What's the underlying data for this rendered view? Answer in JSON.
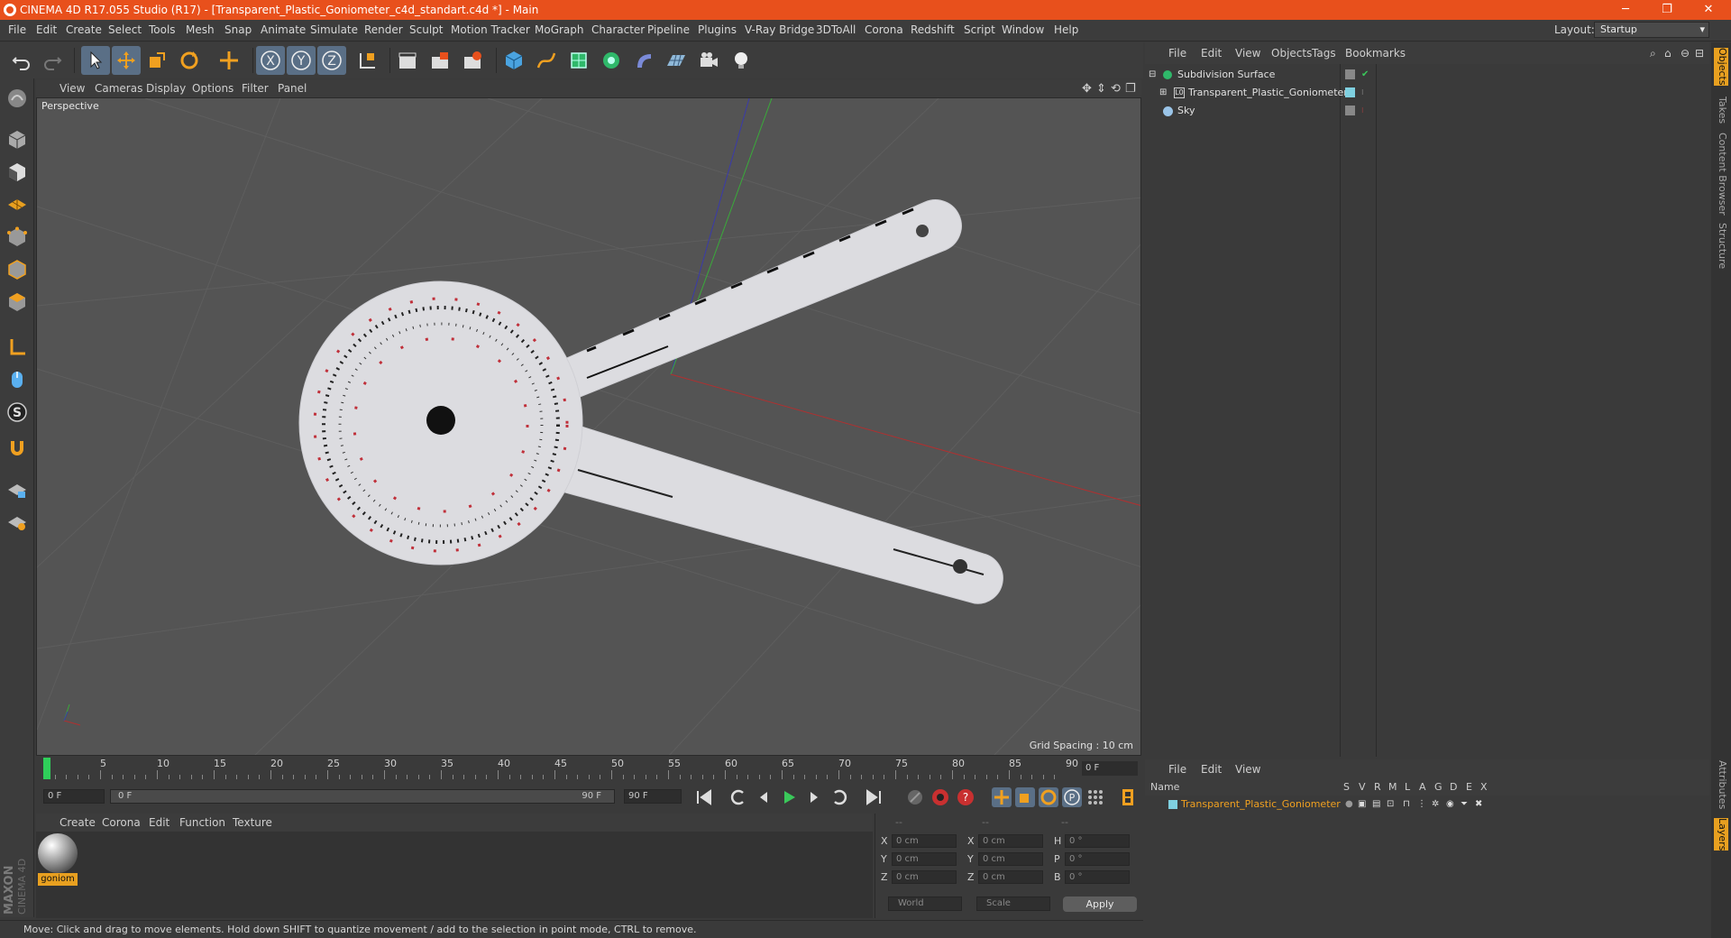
{
  "window": {
    "title": "CINEMA 4D R17.055 Studio (R17) - [Transparent_Plastic_Goniometer_c4d_standart.c4d *] - Main",
    "minimize": "─",
    "restore": "❐",
    "close": "✕"
  },
  "menu": [
    "File",
    "Edit",
    "Create",
    "Select",
    "Tools",
    "Mesh",
    "Snap",
    "Animate",
    "Simulate",
    "Render",
    "Sculpt",
    "Motion Tracker",
    "MoGraph",
    "Character",
    "Pipeline",
    "Plugins",
    "V-Ray Bridge",
    "3DToAll",
    "Corona",
    "Redshift",
    "Script",
    "Window",
    "Help"
  ],
  "layout": {
    "label": "Layout:",
    "value": "Startup"
  },
  "viewport": {
    "menu": [
      "View",
      "Cameras",
      "Display",
      "Options",
      "Filter",
      "Panel"
    ],
    "label": "Perspective",
    "grid_spacing": "Grid Spacing : 10 cm"
  },
  "timeline": {
    "ticks": [
      "0",
      "5",
      "10",
      "15",
      "20",
      "25",
      "30",
      "35",
      "40",
      "45",
      "50",
      "55",
      "60",
      "65",
      "70",
      "75",
      "80",
      "85",
      "90"
    ],
    "current_frame": "0 F",
    "start_field": "0 F",
    "range_start": "0 F",
    "range_end": "90 F",
    "end_field": "90 F"
  },
  "material_manager": {
    "menu": [
      "Create",
      "Corona",
      "Edit",
      "Function",
      "Texture"
    ],
    "material_name": "goniom"
  },
  "coordinates": {
    "header": [
      "--",
      "--",
      "--"
    ],
    "rows": [
      {
        "l1": "X",
        "v1": "0 cm",
        "l2": "X",
        "v2": "0 cm",
        "l3": "H",
        "v3": "0 °"
      },
      {
        "l1": "Y",
        "v1": "0 cm",
        "l2": "Y",
        "v2": "0 cm",
        "l3": "P",
        "v3": "0 °"
      },
      {
        "l1": "Z",
        "v1": "0 cm",
        "l2": "Z",
        "v2": "0 cm",
        "l3": "B",
        "v3": "0 °"
      }
    ],
    "mode": "World",
    "scale": "Scale",
    "apply": "Apply"
  },
  "status": "Move: Click and drag to move elements. Hold down SHIFT to quantize movement / add to the selection in point mode, CTRL to remove.",
  "object_manager": {
    "menu": [
      "File",
      "Edit",
      "View",
      "Objects",
      "Tags",
      "Bookmarks"
    ],
    "objects": [
      {
        "name": "Subdivision Surface"
      },
      {
        "name": "Transparent_Plastic_Goniometer"
      },
      {
        "name": "Sky"
      }
    ]
  },
  "layer_manager": {
    "menu": [
      "File",
      "Edit",
      "View"
    ],
    "columns": [
      "Name",
      "S",
      "V",
      "R",
      "M",
      "L",
      "A",
      "G",
      "D",
      "E",
      "X"
    ],
    "layers": [
      {
        "name": "Transparent_Plastic_Goniometer",
        "color": "#7fd0e0"
      }
    ]
  },
  "right_tabs": [
    "Objects",
    "Takes",
    "Content Browser",
    "Structure",
    "Attributes",
    "Layers"
  ],
  "colors": {
    "accent": "#e8501c",
    "selection": "#e8a020",
    "active_tool": "#5a6f86"
  }
}
